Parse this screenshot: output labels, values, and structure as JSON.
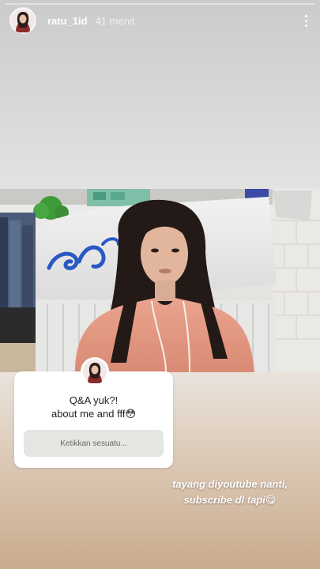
{
  "header": {
    "username": "ratu_1id",
    "time": "41 menit",
    "more_icon": "more-vertical-icon"
  },
  "question_sticker": {
    "title_line1": "Q&A yuk?!",
    "title_line2": "about me and fff😳",
    "input_placeholder": "Ketikkan sesuatu..."
  },
  "caption": {
    "line1": "tayang diyoutube nanti,",
    "line2": "subscribe dl tapi😋"
  },
  "colors": {
    "sticker_bg": "#ffffff",
    "input_bg": "#e4e6e2",
    "text_dark": "#222222",
    "caption_text": "#ffffff",
    "store_sign_blue": "#2a58c4"
  }
}
